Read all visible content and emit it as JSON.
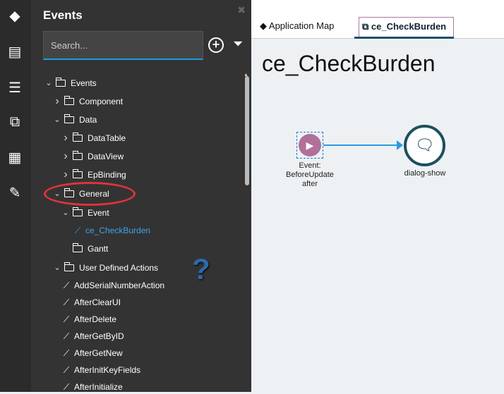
{
  "panel": {
    "title": "Events",
    "search_placeholder": "Search..."
  },
  "tree": [
    {
      "label": "Events",
      "level": 0,
      "chevron": "down",
      "icon": "folder"
    },
    {
      "label": "Component",
      "level": 1,
      "chevron": "right",
      "icon": "folder"
    },
    {
      "label": "Data",
      "level": 1,
      "chevron": "down",
      "icon": "folder"
    },
    {
      "label": "DataTable",
      "level": 2,
      "chevron": "right",
      "icon": "folder"
    },
    {
      "label": "DataView",
      "level": 2,
      "chevron": "right",
      "icon": "folder"
    },
    {
      "label": "EpBinding",
      "level": 2,
      "chevron": "right",
      "icon": "folder"
    },
    {
      "label": "General",
      "level": 1,
      "chevron": "down",
      "icon": "folder"
    },
    {
      "label": "Event",
      "level": 2,
      "chevron": "down",
      "icon": "folder"
    },
    {
      "label": "ce_CheckBurden",
      "level": 3,
      "chevron": "",
      "icon": "link",
      "selected": true
    },
    {
      "label": "Gantt",
      "level": 2,
      "chevron": "",
      "icon": "folder"
    },
    {
      "label": "User Defined Actions",
      "level": 1,
      "chevron": "down",
      "icon": "folder"
    },
    {
      "label": "AddSerialNumberAction",
      "level": 2,
      "chevron": "",
      "icon": "link"
    },
    {
      "label": "AfterClearUI",
      "level": 2,
      "chevron": "",
      "icon": "link"
    },
    {
      "label": "AfterDelete",
      "level": 2,
      "chevron": "",
      "icon": "link"
    },
    {
      "label": "AfterGetByID",
      "level": 2,
      "chevron": "",
      "icon": "link"
    },
    {
      "label": "AfterGetNew",
      "level": 2,
      "chevron": "",
      "icon": "link"
    },
    {
      "label": "AfterInitKeyFields",
      "level": 2,
      "chevron": "",
      "icon": "link"
    },
    {
      "label": "AfterInitialize",
      "level": 2,
      "chevron": "",
      "icon": "link"
    }
  ],
  "tabs": [
    {
      "label": "Application Map"
    },
    {
      "label": "ce_CheckBurden",
      "active": true
    }
  ],
  "canvas": {
    "title": "ce_CheckBurden",
    "start_label_1": "Event:",
    "start_label_2": "BeforeUpdate",
    "start_label_3": "after",
    "action_label": "dialog-show"
  },
  "annotation": {
    "question": "?"
  }
}
